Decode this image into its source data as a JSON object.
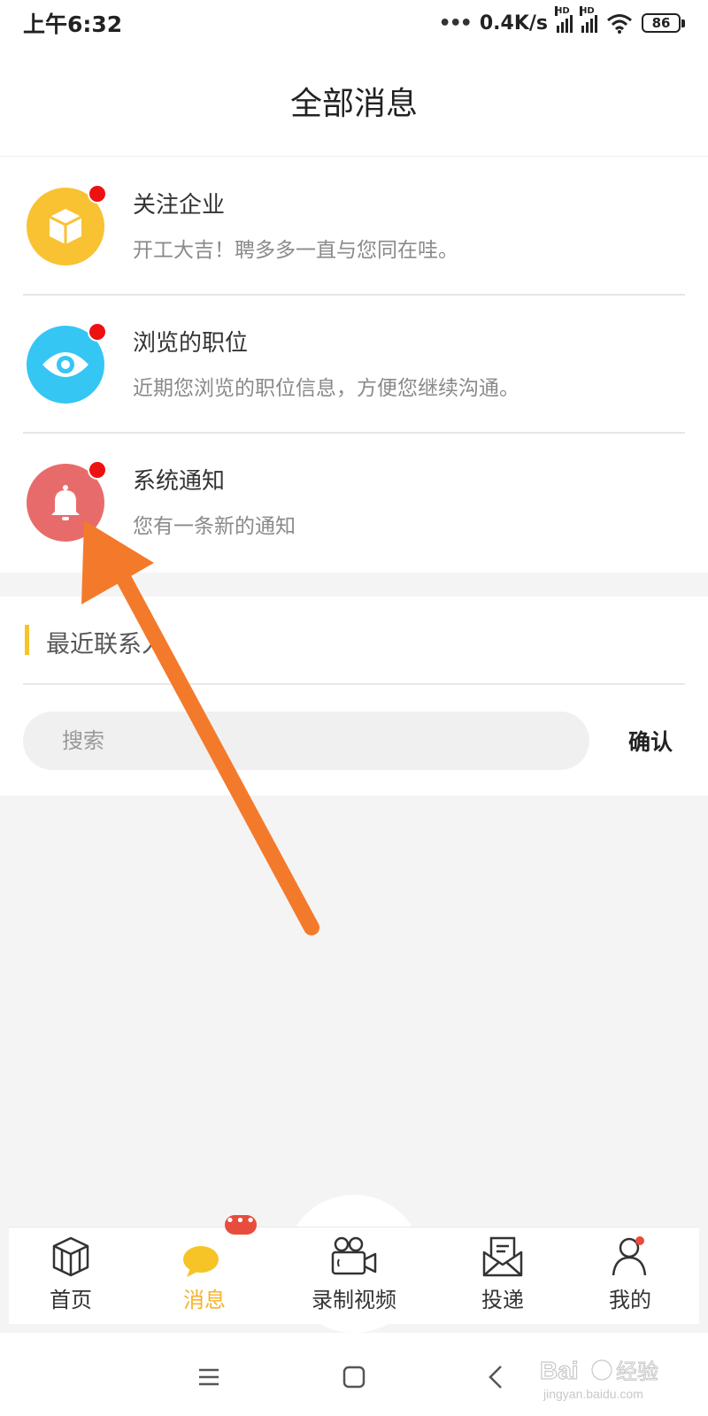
{
  "status_bar": {
    "time": "上午6:32",
    "net_speed": "0.4K/s",
    "signal_badge": "HD",
    "battery": "86"
  },
  "header": {
    "title": "全部消息"
  },
  "messages": [
    {
      "title": "关注企业",
      "desc": "开工大吉！聘多多一直与您同在哇。",
      "icon": "box-icon",
      "color": "#f8c232",
      "unread": true
    },
    {
      "title": "浏览的职位",
      "desc": "近期您浏览的职位信息，方便您继续沟通。",
      "icon": "eye-icon",
      "color": "#35c6f4",
      "unread": true
    },
    {
      "title": "系统通知",
      "desc": "您有一条新的通知",
      "icon": "bell-icon",
      "color": "#e86b6b",
      "unread": true
    }
  ],
  "recent_contacts": {
    "title": "最近联系人",
    "search_placeholder": "搜索",
    "confirm_label": "确认"
  },
  "tab_bar": {
    "tabs": [
      {
        "label": "首页",
        "icon": "cube-icon",
        "active": false
      },
      {
        "label": "消息",
        "icon": "chat-bubble-icon",
        "active": true,
        "badge": "•••"
      },
      {
        "label": "录制视频",
        "icon": "video-camera-icon",
        "active": false
      },
      {
        "label": "投递",
        "icon": "envelope-icon",
        "active": false
      },
      {
        "label": "我的",
        "icon": "person-icon",
        "active": false,
        "dot": true
      }
    ]
  },
  "colors": {
    "accent": "#f6b32b",
    "unread_dot": "#ee1111",
    "annotation_arrow": "#f47a2b"
  }
}
